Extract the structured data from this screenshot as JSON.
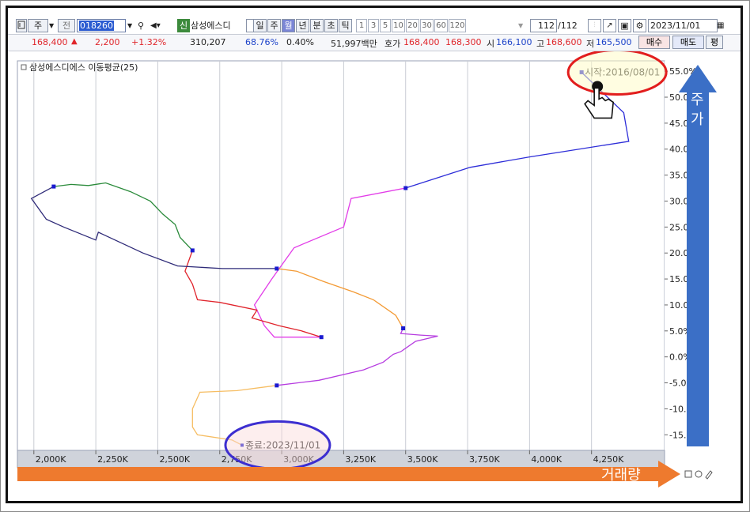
{
  "toolbar": {
    "buttons1": [
      "주",
      "전"
    ],
    "code": "018260",
    "name_badge": "신",
    "stock_name": "삼성에스디",
    "periods": [
      "일",
      "주",
      "월",
      "년",
      "분",
      "초",
      "틱"
    ],
    "intervals": [
      "1",
      "3",
      "5",
      "10",
      "20",
      "30",
      "60",
      "120"
    ],
    "count": "112",
    "count_total": "/112",
    "date": "2023/11/01"
  },
  "quote": {
    "price": "168,400",
    "change": "2,200",
    "change_pct": "+1.32%",
    "volume": "310,207",
    "ratio1": "68.76%",
    "ratio2": "0.40%",
    "amount": "51,997백만",
    "hoga_label": "호가",
    "hoga1": "168,400",
    "hoga2": "168,300",
    "open_label": "시",
    "open": "166,100",
    "high_label": "고",
    "high": "168,600",
    "low_label": "저",
    "low": "165,500",
    "buy_btn": "매수",
    "sell_btn": "매도",
    "eval_btn": "평"
  },
  "annotations": {
    "y_arrow_label_1": "주",
    "y_arrow_label_2": "가",
    "x_arrow_label": "거래량"
  },
  "colors": {
    "start_ellipse": "#e21d1d",
    "end_ellipse": "#3c2ed0",
    "y_arrow": "#3b6fc6",
    "x_arrow": "#ee7a2e"
  },
  "chart_data": {
    "type": "line",
    "title": "삼성에스디에스 이동평균(25)",
    "xlabel": "",
    "ylabel": "",
    "xlim": [
      1940000,
      4500000
    ],
    "ylim": [
      -18,
      57
    ],
    "x_ticks": [
      "2,000K",
      "2,250K",
      "2,500K",
      "2,750K",
      "3,000K",
      "3,250K",
      "3,500K",
      "3,750K",
      "4,000K",
      "4,250K"
    ],
    "y_ticks": [
      "55.0%",
      "50.0%",
      "45.0%",
      "40.0%",
      "35.0%",
      "30.0%",
      "25.0%",
      "20.0%",
      "15.0%",
      "10.0%",
      "5.0%",
      "0.0%",
      "-5.0%",
      "-10.0%",
      "-15.0%"
    ],
    "start_label": "시작:2016/08/01",
    "end_label": "종료:2023/11/01",
    "grid": true,
    "series": [
      {
        "color": "#2d2dd8",
        "points": [
          [
            4210000,
            54.8
          ],
          [
            4380000,
            47.0
          ],
          [
            4400000,
            41.5
          ],
          [
            4000000,
            38.5
          ],
          [
            3760000,
            36.5
          ],
          [
            3500000,
            32.5
          ]
        ]
      },
      {
        "color": "#e23ce8",
        "points": [
          [
            3500000,
            32.5
          ],
          [
            3280000,
            30.5
          ],
          [
            3250000,
            25.0
          ],
          [
            3050000,
            21.0
          ],
          [
            2960000,
            15.0
          ],
          [
            2890000,
            10.0
          ],
          [
            2930000,
            6.0
          ],
          [
            2970000,
            3.8
          ],
          [
            3160000,
            3.8
          ]
        ]
      },
      {
        "color": "#e0242c",
        "points": [
          [
            3160000,
            3.8
          ],
          [
            3080000,
            5.0
          ],
          [
            2990000,
            6.0
          ],
          [
            2880000,
            7.5
          ],
          [
            2900000,
            9.0
          ],
          [
            2750000,
            10.5
          ],
          [
            2660000,
            11.0
          ],
          [
            2640000,
            14.0
          ],
          [
            2610000,
            16.5
          ],
          [
            2640000,
            20.5
          ]
        ]
      },
      {
        "color": "#2a8a3a",
        "points": [
          [
            2640000,
            20.5
          ],
          [
            2590000,
            23.0
          ],
          [
            2570000,
            25.5
          ],
          [
            2520000,
            27.5
          ],
          [
            2470000,
            30.0
          ],
          [
            2390000,
            31.8
          ],
          [
            2290000,
            33.5
          ],
          [
            2220000,
            33.0
          ],
          [
            2150000,
            33.2
          ],
          [
            2080000,
            32.8
          ]
        ]
      },
      {
        "color": "#2e2a78",
        "points": [
          [
            2080000,
            32.8
          ],
          [
            1990000,
            30.5
          ],
          [
            2050000,
            26.5
          ],
          [
            2120000,
            25.0
          ],
          [
            2250000,
            22.5
          ],
          [
            2260000,
            24.0
          ],
          [
            2440000,
            20.0
          ],
          [
            2580000,
            17.5
          ],
          [
            2760000,
            17.0
          ],
          [
            2980000,
            17.0
          ]
        ]
      },
      {
        "color": "#f39a34",
        "points": [
          [
            2980000,
            17.0
          ],
          [
            3060000,
            16.5
          ],
          [
            3170000,
            14.5
          ],
          [
            3290000,
            12.5
          ],
          [
            3370000,
            11.0
          ],
          [
            3460000,
            8.0
          ],
          [
            3490000,
            5.5
          ]
        ]
      },
      {
        "color": "#b63ce0",
        "points": [
          [
            3490000,
            5.5
          ],
          [
            3480000,
            4.5
          ],
          [
            3560000,
            4.2
          ],
          [
            3630000,
            4.0
          ],
          [
            3540000,
            3.0
          ],
          [
            3480000,
            1.0
          ],
          [
            3450000,
            0.5
          ],
          [
            3410000,
            -1.0
          ],
          [
            3330000,
            -2.5
          ],
          [
            3150000,
            -4.5
          ],
          [
            2980000,
            -5.5
          ]
        ]
      },
      {
        "color": "#f6bd62",
        "points": [
          [
            2980000,
            -5.5
          ],
          [
            2820000,
            -6.5
          ],
          [
            2670000,
            -6.8
          ],
          [
            2640000,
            -10.0
          ],
          [
            2640000,
            -13.5
          ],
          [
            2660000,
            -15.0
          ],
          [
            2800000,
            -16.0
          ],
          [
            2840000,
            -17.0
          ]
        ]
      }
    ]
  }
}
